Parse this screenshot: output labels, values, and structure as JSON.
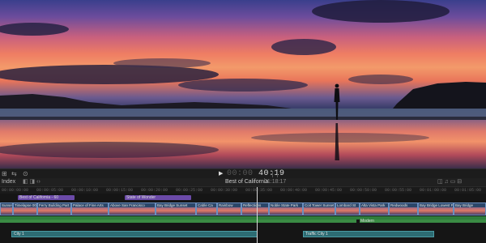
{
  "toolbar": {
    "timecode_dim": "00:00",
    "timecode": "40:19"
  },
  "timeline_header": {
    "index_label": "Index",
    "project_title": "Best of California",
    "duration": "01:18:17"
  },
  "ruler_ticks": [
    "00:00:00:00",
    "00:00:05:00",
    "00:00:10:00",
    "00:00:15:00",
    "00:00:20:00",
    "00:00:25:00",
    "00:00:30:00",
    "00:00:35:00",
    "00:00:40:00",
    "00:00:45:00",
    "00:00:50:00",
    "00:00:55:00",
    "00:01:00:00",
    "00:01:05:00"
  ],
  "markers": [
    "Best of California - 60",
    "State of Wonder"
  ],
  "clips": [
    "Sunset",
    "Timelapse 005",
    "Ferry Building Part 2",
    "Palace of Fine Arts",
    "Above San Francisco",
    "Bay Bridge Sunset",
    "Cable Ca",
    "Rainbow",
    "Reflections",
    "Noble State Park",
    "Coit Tower Sunset",
    "Lombard St",
    "Alta Vista Park",
    "Redwoods",
    "Bay Bridge Lowest Pl",
    "Bay Bridge"
  ],
  "audio": {
    "music_label": "Modern"
  },
  "lower_clips": [
    "City 1",
    "Traffic City 1"
  ]
}
